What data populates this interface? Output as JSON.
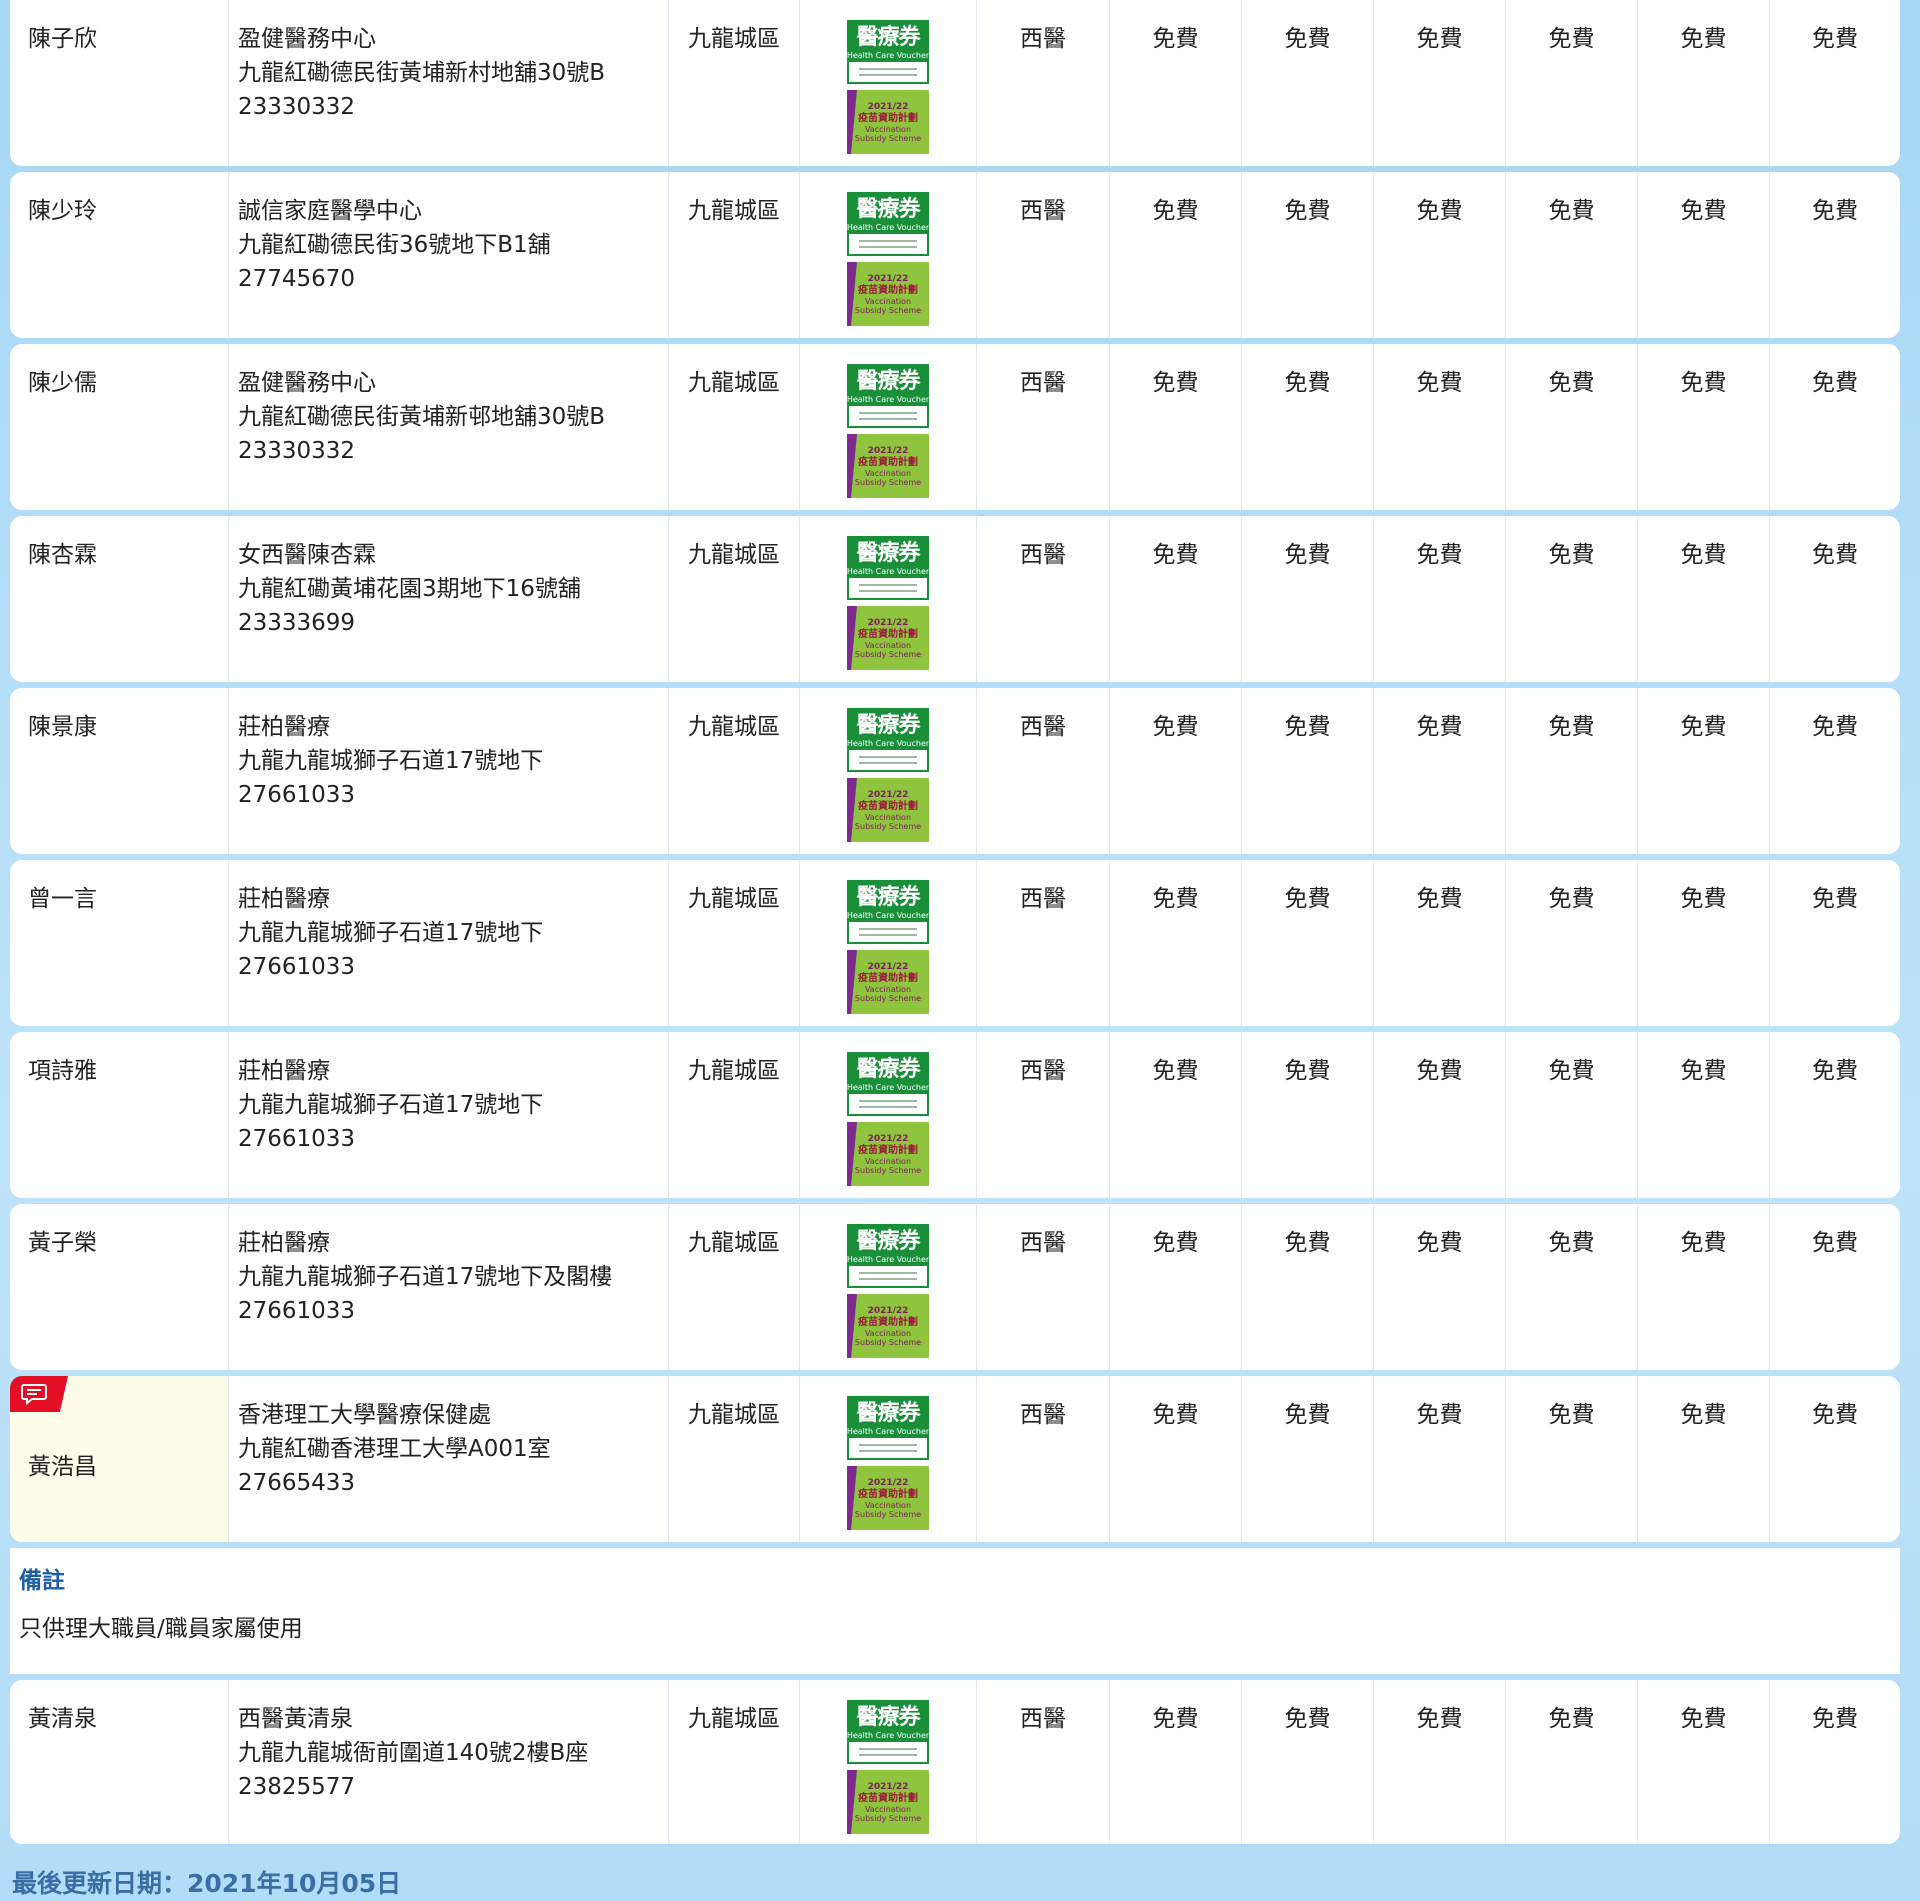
{
  "rows": [
    {
      "name": "陳子欣",
      "clinic": "盈健醫務中心",
      "address": "九龍紅磡德民街黃埔新村地舖30號B",
      "phone": "23330332",
      "district": "九龍城區",
      "type": "西醫",
      "fees": [
        "免費",
        "免費",
        "免費",
        "免費",
        "免費",
        "免費"
      ]
    },
    {
      "name": "陳少玲",
      "clinic": "誠信家庭醫學中心",
      "address": "九龍紅磡德民街36號地下B1舖",
      "phone": "27745670",
      "district": "九龍城區",
      "type": "西醫",
      "fees": [
        "免費",
        "免費",
        "免費",
        "免費",
        "免費",
        "免費"
      ]
    },
    {
      "name": "陳少儒",
      "clinic": "盈健醫務中心",
      "address": "九龍紅磡德民街黃埔新邨地舖30號B",
      "phone": "23330332",
      "district": "九龍城區",
      "type": "西醫",
      "fees": [
        "免費",
        "免費",
        "免費",
        "免費",
        "免費",
        "免費"
      ]
    },
    {
      "name": "陳杏霖",
      "clinic": "女西醫陳杏霖",
      "address": "九龍紅磡黃埔花園3期地下16號舖",
      "phone": "23333699",
      "district": "九龍城區",
      "type": "西醫",
      "fees": [
        "免費",
        "免費",
        "免費",
        "免費",
        "免費",
        "免費"
      ]
    },
    {
      "name": "陳景康",
      "clinic": "莊柏醫療",
      "address": "九龍九龍城獅子石道17號地下",
      "phone": "27661033",
      "district": "九龍城區",
      "type": "西醫",
      "fees": [
        "免費",
        "免費",
        "免費",
        "免費",
        "免費",
        "免費"
      ]
    },
    {
      "name": "曾一言",
      "clinic": "莊柏醫療",
      "address": "九龍九龍城獅子石道17號地下",
      "phone": "27661033",
      "district": "九龍城區",
      "type": "西醫",
      "fees": [
        "免費",
        "免費",
        "免費",
        "免費",
        "免費",
        "免費"
      ]
    },
    {
      "name": "項詩雅",
      "clinic": "莊柏醫療",
      "address": "九龍九龍城獅子石道17號地下",
      "phone": "27661033",
      "district": "九龍城區",
      "type": "西醫",
      "fees": [
        "免費",
        "免費",
        "免費",
        "免費",
        "免費",
        "免費"
      ]
    },
    {
      "name": "黃子榮",
      "clinic": "莊柏醫療",
      "address": "九龍九龍城獅子石道17號地下及閣樓",
      "phone": "27661033",
      "district": "九龍城區",
      "type": "西醫",
      "fees": [
        "免費",
        "免費",
        "免費",
        "免費",
        "免費",
        "免費"
      ]
    },
    {
      "name": "黃浩昌",
      "clinic": "香港理工大學醫療保健處",
      "address": "九龍紅磡香港理工大學A001室",
      "phone": "27665433",
      "district": "九龍城區",
      "type": "西醫",
      "fees": [
        "免費",
        "免費",
        "免費",
        "免費",
        "免費",
        "免費"
      ]
    },
    {
      "name": "黃清泉",
      "clinic": "西醫黃清泉",
      "address": "九龍九龍城衙前圍道140號2樓B座",
      "phone": "23825577",
      "district": "九龍城區",
      "type": "西醫",
      "fees": [
        "免費",
        "免費",
        "免費",
        "免費",
        "免費",
        "免費"
      ]
    }
  ],
  "badges": {
    "hcv_title": "醫療券",
    "hcv_en": "Health Care Voucher",
    "vss_year": "2021/22",
    "vss_title": "疫苗資助計劃",
    "vss_en1": "Vaccination",
    "vss_en2": "Subsidy Scheme"
  },
  "remark": {
    "title": "備註",
    "text": "只供理大職員/職員家屬使用"
  },
  "footer": {
    "updated": "最後更新日期：2021年10月05日"
  },
  "icons": {
    "remark_marker": "chat-bubble-icon"
  },
  "colors": {
    "marker_red": "#e30f24",
    "remark_title": "#1c5fa4",
    "hcv_green": "#1a8f3a",
    "vss_green": "#8fc43e",
    "vss_purple": "#7d2a8e"
  }
}
